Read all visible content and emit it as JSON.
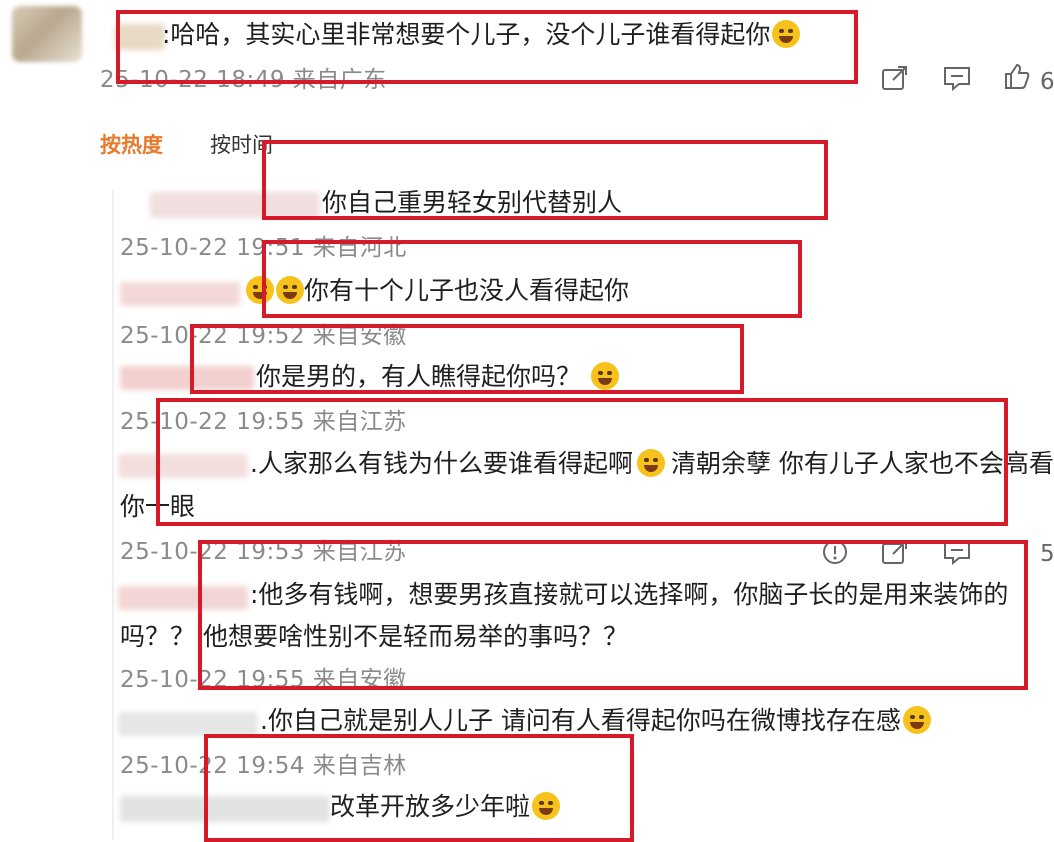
{
  "main_comment": {
    "text": ":哈哈，其实心里非常想要个儿子，没个儿子谁看得起你",
    "meta": "25-10-22 18:49 来自广东"
  },
  "actions": {
    "share_icon": "share-icon",
    "comment_icon": "comment-icon",
    "like_icon": "thumbs-up-icon"
  },
  "sort_tabs": {
    "hot": "按热度",
    "time": "按时间"
  },
  "replies": [
    {
      "text": "你自己重男轻女别代替别人",
      "meta": "25-10-22 19:51 来自河北"
    },
    {
      "text": "你有十个儿子也没人看得起你",
      "meta": "25-10-22 19:52 来自安徽"
    },
    {
      "text": "你是男的，有人瞧得起你吗？",
      "meta": "25-10-22 19:55 来自江苏"
    },
    {
      "text": ".人家那么有钱为什么要谁看得起啊",
      "text2": "清朝余孽 你有儿子人家也不会高看",
      "text3": "你一眼",
      "meta": "25-10-22 19:53 来自江苏"
    },
    {
      "text": ":他多有钱啊，想要男孩直接就可以选择啊，你脑子长的是用来装饰的",
      "text2": "吗？？ 他想要啥性别不是轻而易举的事吗？？",
      "meta": "25-10-22 19:55 来自安徽"
    },
    {
      "text": ".你自己就是别人儿子 请问有人看得起你吗在微博找存在感",
      "meta": "25-10-22 19:54 来自吉林"
    },
    {
      "text": "改革开放多少年啦"
    }
  ],
  "reply_actions": {
    "report_icon": "info-icon",
    "share_icon": "share-icon",
    "comment_icon": "comment-icon",
    "count": "5"
  },
  "colors": {
    "highlight_box": "#d51a2a",
    "hot_tab": "#e87a2c",
    "meta_text": "#8a8a8a"
  }
}
